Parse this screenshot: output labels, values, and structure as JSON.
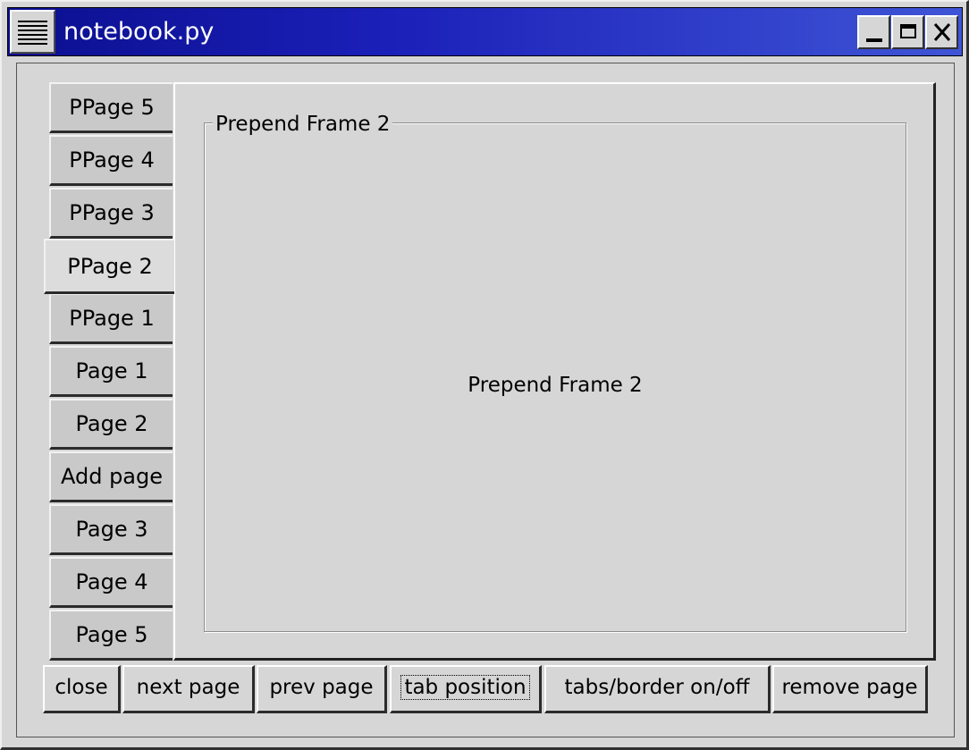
{
  "window": {
    "title": "notebook.py",
    "controls": [
      "minimize-icon",
      "maximize-icon",
      "close-icon"
    ]
  },
  "notebook": {
    "tabs": [
      {
        "label": "PPage 5"
      },
      {
        "label": "PPage 4"
      },
      {
        "label": "PPage 3"
      },
      {
        "label": "PPage 2",
        "active": true
      },
      {
        "label": "PPage 1"
      },
      {
        "label": "Page 1"
      },
      {
        "label": "Page 2"
      },
      {
        "label": "Add page"
      },
      {
        "label": "Page 3"
      },
      {
        "label": "Page 4"
      },
      {
        "label": "Page 5"
      }
    ],
    "page": {
      "frame_label": "Prepend Frame 2",
      "content_label": "Prepend Frame 2"
    }
  },
  "buttons": [
    {
      "label": "close"
    },
    {
      "label": "next page"
    },
    {
      "label": "prev page"
    },
    {
      "label": "tab position",
      "focused": true
    },
    {
      "label": "tabs/border on/off"
    },
    {
      "label": "remove page"
    }
  ],
  "colors": {
    "titlebar_start": "#0b0f8f",
    "titlebar_end": "#3f55d6",
    "background": "#d6d6d6"
  }
}
